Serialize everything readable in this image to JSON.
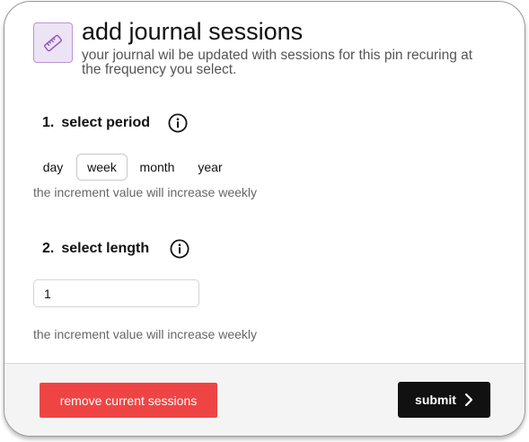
{
  "header": {
    "icon": "ruler-icon",
    "title": "add journal sessions",
    "subtitle": "your journal wil be updated with sessions for this pin recuring at the frequency you select."
  },
  "period_section": {
    "number": "1.",
    "title": "select period",
    "info_icon": "info-circle-icon",
    "options": [
      "day",
      "week",
      "month",
      "year"
    ],
    "selected": "week",
    "helper": "the increment value will increase weekly"
  },
  "length_section": {
    "number": "2.",
    "title": "select length",
    "info_icon": "info-circle-icon",
    "value": "1",
    "helper": "the increment value will increase weekly"
  },
  "footer": {
    "remove_label": "remove current sessions",
    "submit_label": "submit",
    "submit_icon": "chevron-right-icon"
  },
  "colors": {
    "danger": "#ef4444",
    "primary": "#111111",
    "icon_tile_bg": "#ece3f5",
    "icon_tile_border": "#b996d6"
  }
}
